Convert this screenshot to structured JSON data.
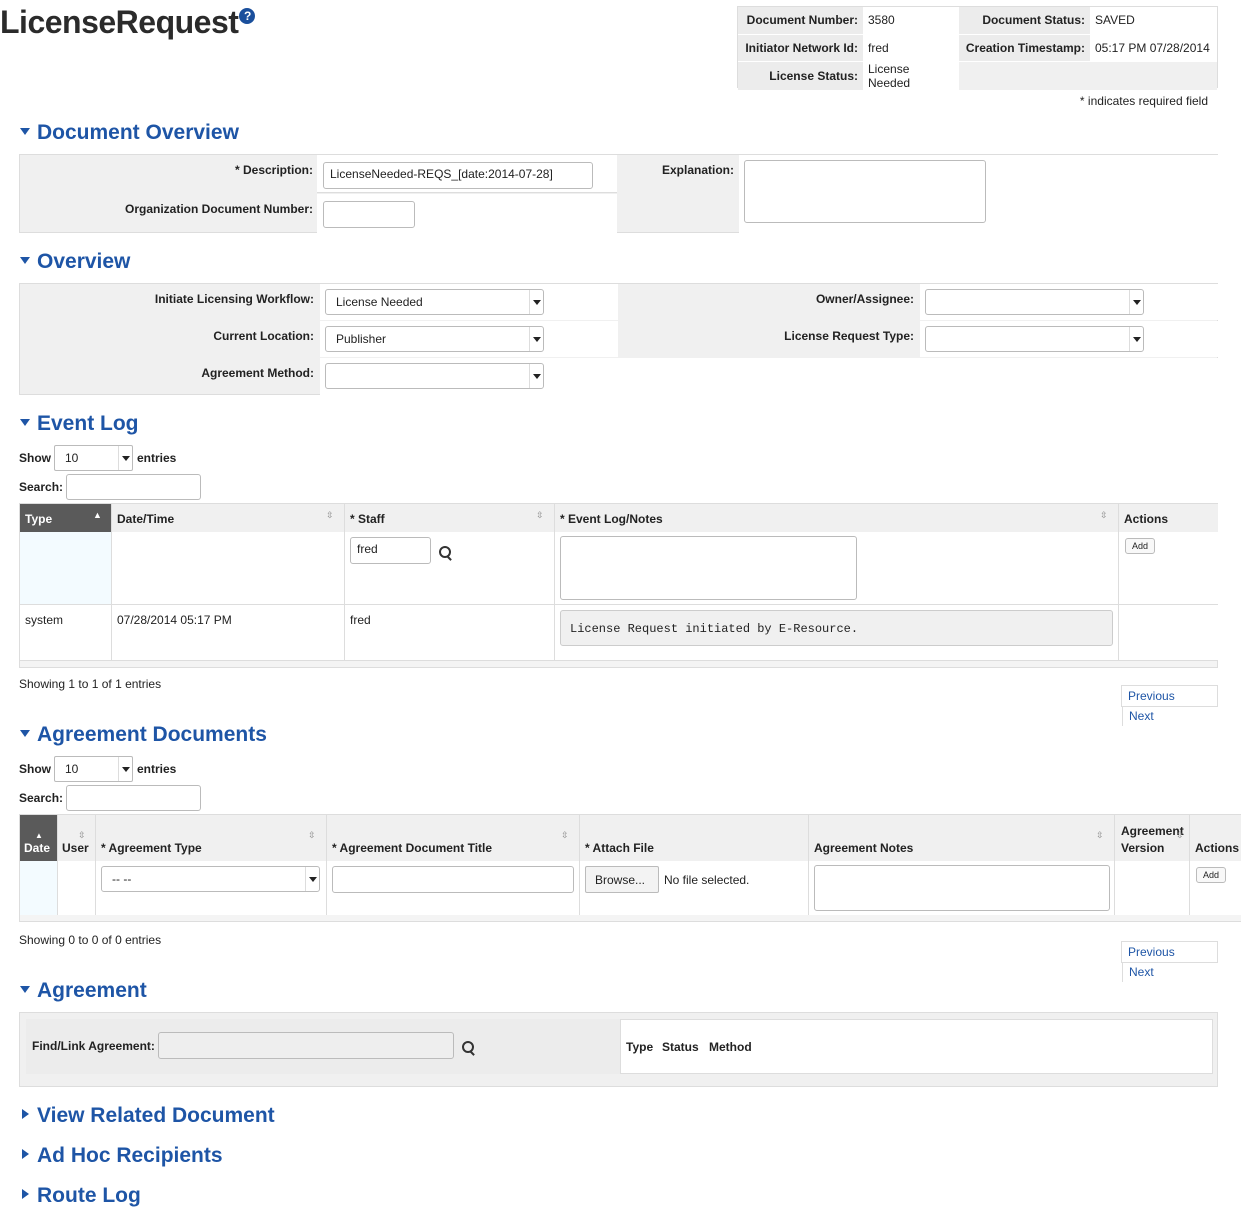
{
  "page": {
    "title": "LicenseRequest",
    "help_icon": "?"
  },
  "header": {
    "doc_number_label": "Document Number:",
    "doc_number": "3580",
    "doc_status_label": "Document Status:",
    "doc_status": "SAVED",
    "initiator_label": "Initiator Network Id:",
    "initiator": "fred",
    "creation_label": "Creation Timestamp:",
    "creation": "05:17 PM 07/28/2014",
    "license_status_label": "License Status:",
    "license_status": "License Needed",
    "required_note": "* indicates required field"
  },
  "doc_overview": {
    "title": "Document Overview",
    "description_label": "* Description:",
    "description_value": "LicenseNeeded-REQS_[date:2014-07-28]",
    "org_doc_label": "Organization Document Number:",
    "org_doc_value": "",
    "explanation_label": "Explanation:"
  },
  "overview": {
    "title": "Overview",
    "workflow_label": "Initiate Licensing Workflow:",
    "workflow_value": "License Needed",
    "location_label": "Current Location:",
    "location_value": "Publisher",
    "method_label": "Agreement Method:",
    "method_value": "",
    "owner_label": "Owner/Assignee:",
    "owner_value": "",
    "request_type_label": "License Request Type:",
    "request_type_value": ""
  },
  "event_log": {
    "title": "Event Log",
    "show_label": "Show",
    "show_value": "10",
    "entries_label": "entries",
    "search_label": "Search:",
    "columns": [
      "Type",
      "Date/Time",
      "* Staff",
      "* Event Log/Notes",
      "Actions"
    ],
    "new_staff": "fred",
    "add_label": "Add",
    "rows": [
      {
        "type": "system",
        "datetime": "07/28/2014 05:17 PM",
        "staff": "fred",
        "notes": "License Request initiated by E-Resource."
      }
    ],
    "showing": "Showing 1 to 1 of 1 entries",
    "prev": "Previous",
    "next": "Next"
  },
  "agreement_docs": {
    "title": "Agreement Documents",
    "show_label": "Show",
    "show_value": "10",
    "entries_label": "entries",
    "search_label": "Search:",
    "columns": [
      "Date",
      "User",
      "* Agreement Type",
      "* Agreement Document Title",
      "* Attach File",
      "Agreement Notes",
      "Agreement Version",
      "Actions"
    ],
    "type_select": "-- --",
    "browse_label": "Browse...",
    "no_file": "No file selected.",
    "add_label": "Add",
    "showing": "Showing 0 to 0 of 0 entries",
    "prev": "Previous",
    "next": "Next"
  },
  "agreement": {
    "title": "Agreement",
    "find_label": "Find/Link Agreement:",
    "col_type": "Type",
    "col_status": "Status",
    "col_method": "Method"
  },
  "collapsed": {
    "related": "View Related Document",
    "adhoc": "Ad Hoc Recipients",
    "route": "Route Log"
  },
  "colors": {
    "accent": "#1e55a6",
    "panel": "#f0f0f0"
  }
}
